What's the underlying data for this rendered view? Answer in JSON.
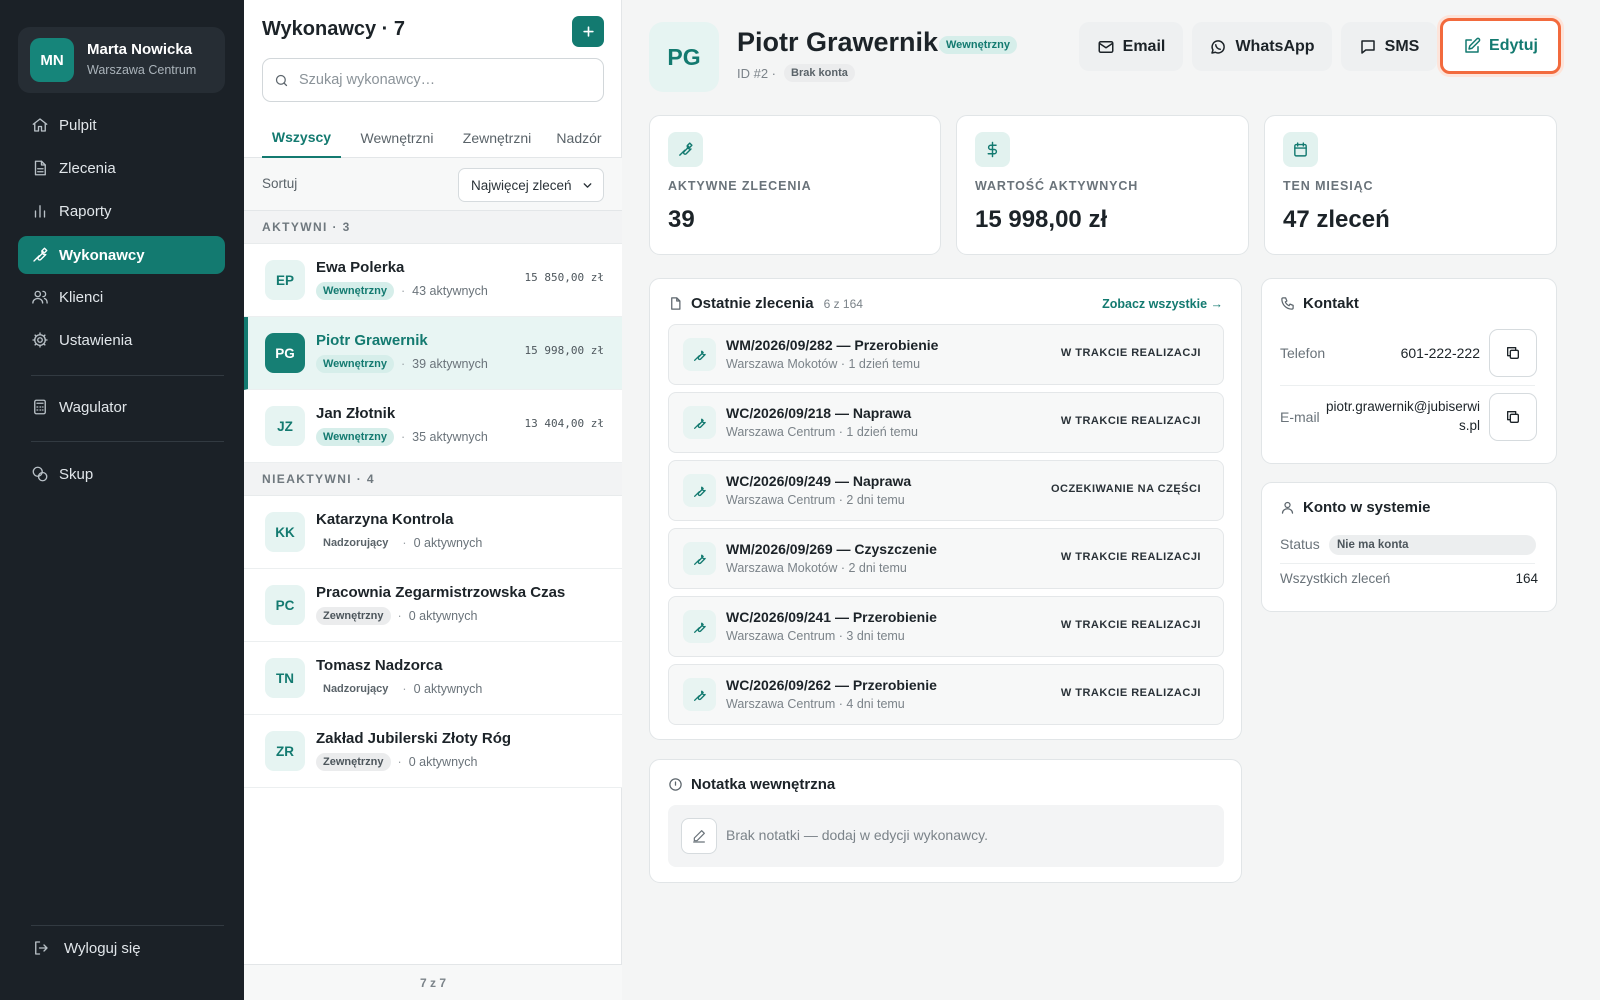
{
  "sidebar": {
    "user": {
      "initials": "MN",
      "name": "Marta Nowicka",
      "location": "Warszawa Centrum"
    },
    "nav": [
      {
        "label": "Pulpit",
        "icon": "home-icon"
      },
      {
        "label": "Zlecenia",
        "icon": "document-icon"
      },
      {
        "label": "Raporty",
        "icon": "bar-chart-icon"
      },
      {
        "label": "Wykonawcy",
        "icon": "wrench-icon",
        "active": true
      },
      {
        "label": "Klienci",
        "icon": "users-icon"
      },
      {
        "label": "Ustawienia",
        "icon": "gear-icon"
      }
    ],
    "tools": [
      {
        "label": "Wagulator",
        "icon": "calculator-icon"
      },
      {
        "label": "Skup",
        "icon": "coins-icon"
      }
    ],
    "logout_label": "Wyloguj się"
  },
  "list": {
    "title": "Wykonawcy · 7",
    "search_placeholder": "Szukaj wykonawcy…",
    "tabs": [
      "Wszyscy",
      "Wewnętrzni",
      "Zewnętrzni",
      "Nadzór"
    ],
    "active_tab": "Wszyscy",
    "sort_label": "Sortuj",
    "sort_value": "Najwięcej zleceń",
    "active_group": "AKTYWNI · 3",
    "inactive_group": "NIEAKTYWNI · 4",
    "active_rows": [
      {
        "initials": "EP",
        "name": "Ewa Polerka",
        "type": "Wewnętrzny",
        "count": "43 aktywnych",
        "amount": "15 850,00 zł"
      },
      {
        "initials": "PG",
        "name": "Piotr Grawernik",
        "type": "Wewnętrzny",
        "count": "39 aktywnych",
        "amount": "15 998,00 zł",
        "selected": true
      },
      {
        "initials": "JZ",
        "name": "Jan Złotnik",
        "type": "Wewnętrzny",
        "count": "35 aktywnych",
        "amount": "13 404,00 zł"
      }
    ],
    "inactive_rows": [
      {
        "initials": "KK",
        "name": "Katarzyna Kontrola",
        "type": "Nadzorujący",
        "count": "0 aktywnych"
      },
      {
        "initials": "PC",
        "name": "Pracownia Zegarmistrzowska Czas",
        "type": "Zewnętrzny",
        "count": "0 aktywnych"
      },
      {
        "initials": "TN",
        "name": "Tomasz Nadzorca",
        "type": "Nadzorujący",
        "count": "0 aktywnych"
      },
      {
        "initials": "ZR",
        "name": "Zakład Jubilerski Złoty Róg",
        "type": "Zewnętrzny",
        "count": "0 aktywnych"
      }
    ],
    "footer": "7 z 7"
  },
  "detail": {
    "initials": "PG",
    "name": "Piotr Grawernik",
    "type_badge": "Wewnętrzny",
    "id_label": "ID #2 ·",
    "account_badge": "Brak konta",
    "actions": {
      "email": "Email",
      "whatsapp": "WhatsApp",
      "sms": "SMS",
      "edit": "Edytuj"
    },
    "stats": [
      {
        "label": "AKTYWNE ZLECENIA",
        "value": "39",
        "icon": "wrench-icon"
      },
      {
        "label": "WARTOŚĆ AKTYWNYCH",
        "value": "15 998,00 zł",
        "icon": "dollar-icon"
      },
      {
        "label": "TEN MIESIĄC",
        "value": "47 zleceń",
        "icon": "calendar-icon"
      }
    ],
    "orders": {
      "title": "Ostatnie zlecenia",
      "count": "6 z 164",
      "see_all": "Zobacz wszystkie →",
      "items": [
        {
          "title": "WM/2026/09/282 — Przerobienie",
          "sub": "Warszawa Mokotów · 1 dzień temu",
          "status": "W TRAKCIE REALIZACJI"
        },
        {
          "title": "WC/2026/09/218 — Naprawa",
          "sub": "Warszawa Centrum · 1 dzień temu",
          "status": "W TRAKCIE REALIZACJI"
        },
        {
          "title": "WC/2026/09/249 — Naprawa",
          "sub": "Warszawa Centrum · 2 dni temu",
          "status": "OCZEKIWANIE NA CZĘŚCI"
        },
        {
          "title": "WM/2026/09/269 — Czyszczenie",
          "sub": "Warszawa Mokotów · 2 dni temu",
          "status": "W TRAKCIE REALIZACJI"
        },
        {
          "title": "WC/2026/09/241 — Przerobienie",
          "sub": "Warszawa Centrum · 3 dni temu",
          "status": "W TRAKCIE REALIZACJI"
        },
        {
          "title": "WC/2026/09/262 — Przerobienie",
          "sub": "Warszawa Centrum · 4 dni temu",
          "status": "W TRAKCIE REALIZACJI"
        }
      ]
    },
    "note": {
      "title": "Notatka wewnętrzna",
      "text": "Brak notatki — dodaj w edycji wykonawcy."
    },
    "contact": {
      "title": "Kontakt",
      "phone_label": "Telefon",
      "phone": "601-222-222",
      "email_label": "E-mail",
      "email_line1": "piotr.grawernik@jubiserwi",
      "email_line2": "s.pl"
    },
    "account": {
      "title": "Konto w systemie",
      "status_label": "Status",
      "status_value": "Nie ma konta",
      "orders_label": "Wszystkich zleceń",
      "orders_value": "164"
    }
  },
  "colors": {
    "accent": "#137a70",
    "sidebar": "#1b2127",
    "edit_outline": "#f26a3d"
  }
}
